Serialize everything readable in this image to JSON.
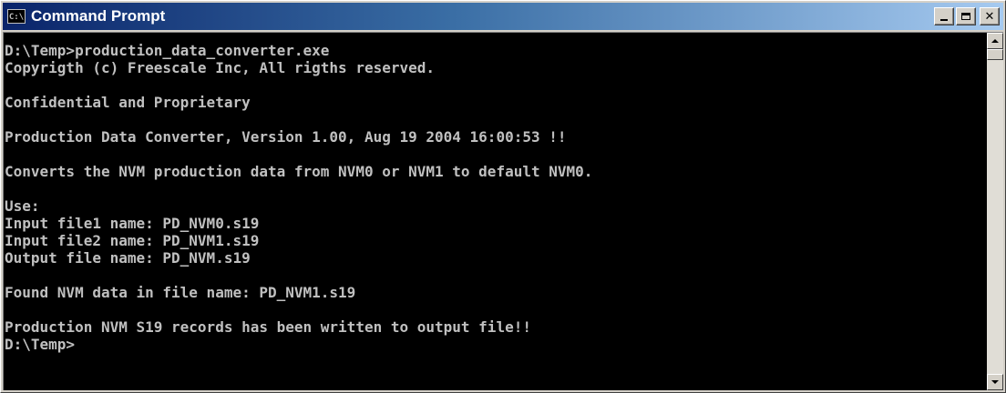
{
  "window": {
    "title": "Command Prompt",
    "icon_label": "C:\\",
    "icon": "console-icon",
    "buttons": {
      "minimize_icon": "minimize-icon",
      "maximize_icon": "maximize-icon",
      "close_icon": "close-icon",
      "close_glyph": "✕"
    }
  },
  "console": {
    "text_color": "#c0c0c0",
    "background": "#000000",
    "lines": [
      "D:\\Temp>production_data_converter.exe",
      "Copyrigth (c) Freescale Inc, All rigths reserved.",
      "",
      "Confidential and Proprietary",
      "",
      "Production Data Converter, Version 1.00, Aug 19 2004 16:00:53 !!",
      "",
      "Converts the NVM production data from NVM0 or NVM1 to default NVM0.",
      "",
      "Use:",
      "Input file1 name: PD_NVM0.s19",
      "Input file2 name: PD_NVM1.s19",
      "Output file name: PD_NVM.s19",
      "",
      "Found NVM data in file name: PD_NVM1.s19",
      "",
      "Production NVM S19 records has been written to output file!!",
      "D:\\Temp>"
    ]
  },
  "colors": {
    "titlebar_start": "#0a246a",
    "titlebar_end": "#a6caf0",
    "chrome": "#d4d0c8"
  }
}
